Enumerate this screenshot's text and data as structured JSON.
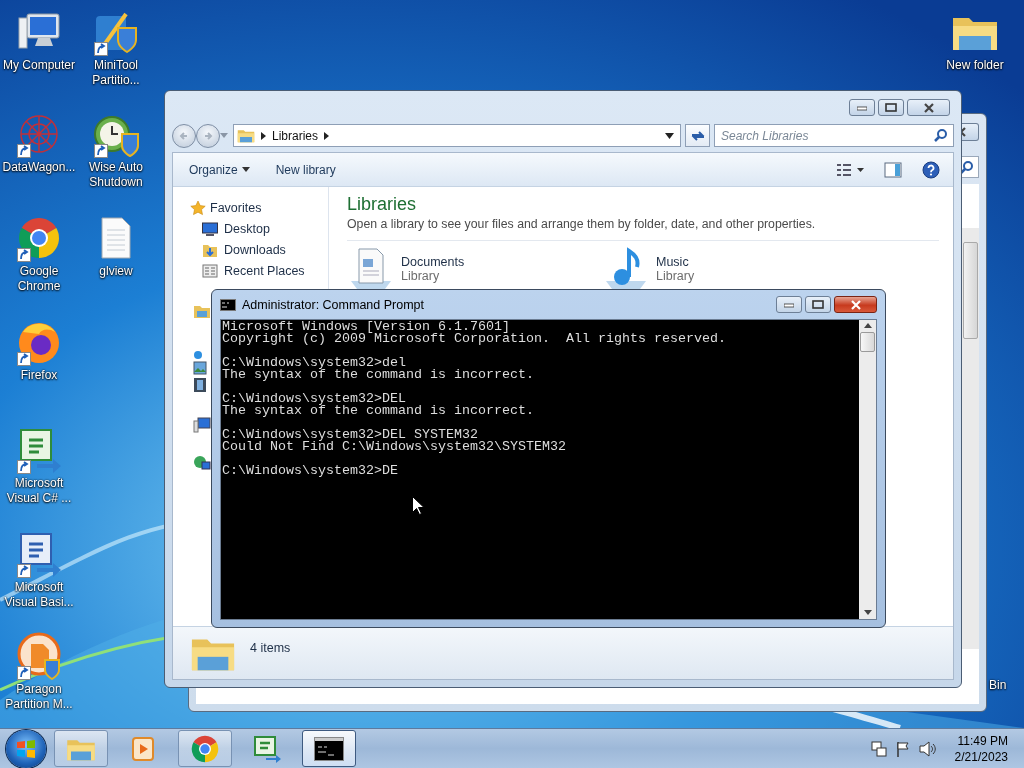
{
  "desktop_icons": [
    {
      "label": "My Computer",
      "kind": "computer",
      "shortcut": false
    },
    {
      "label": "MiniTool Partitio...",
      "kind": "minitool",
      "shortcut": true
    },
    {
      "label": "DataWagon...",
      "kind": "datawagon",
      "shortcut": true
    },
    {
      "label": "Wise Auto Shutdown",
      "kind": "wise",
      "shortcut": true
    },
    {
      "label": "Google Chrome",
      "kind": "chrome",
      "shortcut": true
    },
    {
      "label": "glview",
      "kind": "textfile",
      "shortcut": false
    },
    {
      "label": "Firefox",
      "kind": "firefox",
      "shortcut": true
    },
    {
      "label": "Microsoft Visual C# ...",
      "kind": "csharp",
      "shortcut": true
    },
    {
      "label": "Microsoft Visual Basi...",
      "kind": "vb",
      "shortcut": true
    },
    {
      "label": "Paragon Partition M...",
      "kind": "paragon",
      "shortcut": true
    },
    {
      "label": "New folder",
      "kind": "folder",
      "shortcut": false
    },
    {
      "label": "Bin",
      "kind": "bin",
      "shortcut": false
    }
  ],
  "explorer": {
    "breadcrumb": "Libraries",
    "search_placeholder": "Search Libraries",
    "toolbar": [
      {
        "label": "Organize",
        "dropdown": true
      },
      {
        "label": "New library",
        "dropdown": false
      }
    ],
    "favorites": {
      "label": "Favorites",
      "items": [
        {
          "label": "Desktop",
          "kind": "desktop"
        },
        {
          "label": "Downloads",
          "kind": "downloads"
        },
        {
          "label": "Recent Places",
          "kind": "recent"
        }
      ]
    },
    "heading": "Libraries",
    "description": "Open a library to see your files and arrange them by folder, date, and other properties.",
    "libraries": [
      {
        "name": "Documents",
        "type": "Library",
        "kind": "documents"
      },
      {
        "name": "Music",
        "type": "Library",
        "kind": "music"
      }
    ],
    "status": "4 items"
  },
  "cmd": {
    "title": "Administrator: Command Prompt",
    "blocks": [
      [
        "Microsoft Windows [Version 6.1.7601]",
        "Copyright (c) 2009 Microsoft Corporation.  All rights reserved."
      ],
      [
        "C:\\Windows\\system32>del",
        "The syntax of the command is incorrect."
      ],
      [
        "C:\\Windows\\system32>DEL",
        "The syntax of the command is incorrect."
      ],
      [
        "C:\\Windows\\system32>DEL SYSTEM32",
        "Could Not Find C:\\Windows\\system32\\SYSTEM32"
      ],
      [
        "C:\\Windows\\system32>DE"
      ]
    ]
  },
  "taskbar": {
    "buttons": [
      {
        "kind": "explorer",
        "running": true,
        "selected": false
      },
      {
        "kind": "media",
        "running": false,
        "selected": false
      },
      {
        "kind": "chrome",
        "running": true,
        "selected": false
      },
      {
        "kind": "csharp",
        "running": false,
        "selected": false
      },
      {
        "kind": "cmd",
        "running": true,
        "selected": true
      }
    ],
    "time": "11:49 PM",
    "date": "2/21/2023"
  }
}
